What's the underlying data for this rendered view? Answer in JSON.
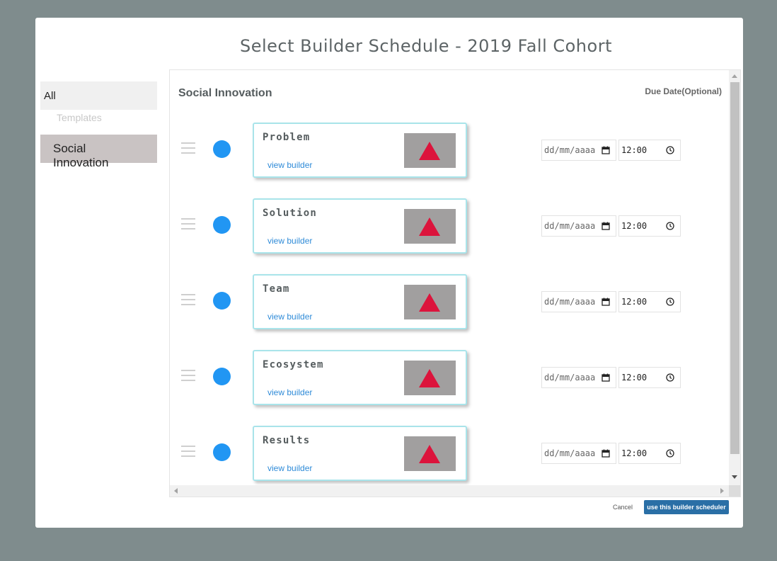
{
  "modal": {
    "title": "Select Builder Schedule - 2019 Fall Cohort"
  },
  "sidebar": {
    "all_label": "All",
    "templates_label": "Templates",
    "items": [
      {
        "label": "Social Innovation",
        "selected": true
      }
    ]
  },
  "panel": {
    "section_title": "Social Innovation",
    "due_date_label": "Due Date(Optional)",
    "builders": [
      {
        "title": "Problem",
        "link": "view builder",
        "date_placeholder": "dd/mm/aaaa",
        "time": "12:00",
        "status_color": "#2196f3"
      },
      {
        "title": "Solution",
        "link": "view builder",
        "date_placeholder": "dd/mm/aaaa",
        "time": "12:00",
        "status_color": "#2196f3"
      },
      {
        "title": "Team",
        "link": "view builder",
        "date_placeholder": "dd/mm/aaaa",
        "time": "12:00",
        "status_color": "#2196f3"
      },
      {
        "title": "Ecosystem",
        "link": "view builder",
        "date_placeholder": "dd/mm/aaaa",
        "time": "12:00",
        "status_color": "#2196f3"
      },
      {
        "title": "Results",
        "link": "view builder",
        "date_placeholder": "dd/mm/aaaa",
        "time": "12:00",
        "status_color": "#2196f3"
      }
    ]
  },
  "footer": {
    "cancel_label": "Cancel",
    "confirm_label": "use this builder scheduler"
  },
  "icons": {
    "thumbnail": "warning-triangle-icon",
    "date": "calendar-icon",
    "time": "clock-icon",
    "drag": "drag-handle-icon"
  },
  "colors": {
    "accent": "#2196f3",
    "card_border": "#a9e4ea",
    "primary_button": "#2a6fa6",
    "triangle": "#dc143c"
  }
}
